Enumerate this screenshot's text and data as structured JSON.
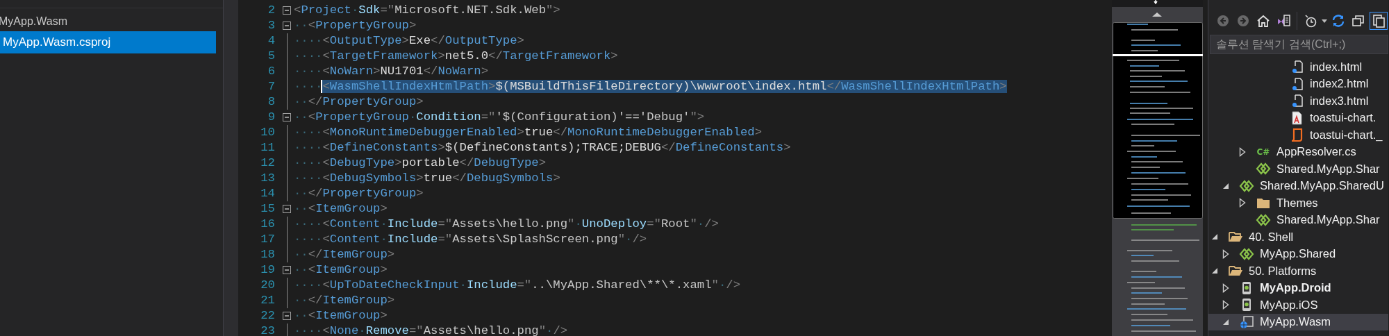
{
  "left_panel": {
    "project": "MyApp.Wasm",
    "files": [
      {
        "label": "MyApp.Wasm.csproj",
        "selected": true
      }
    ]
  },
  "editor": {
    "lines": [
      {
        "number": "2",
        "selected": false,
        "expanded": true,
        "tokens": [
          {
            "kind": "punct",
            "text": "<"
          },
          {
            "kind": "tag",
            "text": "Project"
          },
          {
            "kind": "space",
            "text": "·"
          },
          {
            "kind": "attr",
            "text": "Sdk"
          },
          {
            "kind": "punct",
            "text": "=\""
          },
          {
            "kind": "value",
            "text": "Microsoft.NET.Sdk.Web"
          },
          {
            "kind": "punct",
            "text": "\">"
          }
        ]
      },
      {
        "number": "3",
        "selected": false,
        "expanded": true,
        "indent": "··",
        "tokens": [
          {
            "kind": "punct",
            "text": "<"
          },
          {
            "kind": "tag",
            "text": "PropertyGroup"
          },
          {
            "kind": "punct",
            "text": ">"
          }
        ]
      },
      {
        "number": "4",
        "selected": false,
        "indent": "····",
        "tokens": [
          {
            "kind": "punct",
            "text": "<"
          },
          {
            "kind": "tag",
            "text": "OutputType"
          },
          {
            "kind": "punct",
            "text": ">"
          },
          {
            "kind": "text",
            "text": "Exe"
          },
          {
            "kind": "punct",
            "text": "</"
          },
          {
            "kind": "tag",
            "text": "OutputType"
          },
          {
            "kind": "punct",
            "text": ">"
          }
        ]
      },
      {
        "number": "5",
        "selected": false,
        "indent": "····",
        "tokens": [
          {
            "kind": "punct",
            "text": "<"
          },
          {
            "kind": "tag",
            "text": "TargetFramework"
          },
          {
            "kind": "punct",
            "text": ">"
          },
          {
            "kind": "text",
            "text": "net5.0"
          },
          {
            "kind": "punct",
            "text": "</"
          },
          {
            "kind": "tag",
            "text": "TargetFramework"
          },
          {
            "kind": "punct",
            "text": ">"
          }
        ]
      },
      {
        "number": "6",
        "selected": false,
        "indent": "····",
        "tokens": [
          {
            "kind": "punct",
            "text": "<"
          },
          {
            "kind": "tag",
            "text": "NoWarn"
          },
          {
            "kind": "punct",
            "text": ">"
          },
          {
            "kind": "text",
            "text": "NU1701"
          },
          {
            "kind": "punct",
            "text": "</"
          },
          {
            "kind": "tag",
            "text": "NoWarn"
          },
          {
            "kind": "punct",
            "text": ">"
          }
        ]
      },
      {
        "number": "7",
        "selected": true,
        "indent": "····",
        "tokens": [
          {
            "kind": "punct",
            "text": "<"
          },
          {
            "kind": "tag",
            "text": "WasmShellIndexHtmlPath"
          },
          {
            "kind": "punct",
            "text": ">"
          },
          {
            "kind": "text",
            "text": "$(MSBuildThisFileDirectory)\\wwwroot\\index.html"
          },
          {
            "kind": "punct",
            "text": "</"
          },
          {
            "kind": "tag",
            "text": "WasmShellIndexHtmlPath"
          },
          {
            "kind": "punct",
            "text": ">"
          }
        ]
      },
      {
        "number": "8",
        "selected": false,
        "indent": "··",
        "tokens": [
          {
            "kind": "punct",
            "text": "</"
          },
          {
            "kind": "tag",
            "text": "PropertyGroup"
          },
          {
            "kind": "punct",
            "text": ">"
          }
        ]
      },
      {
        "number": "9",
        "selected": false,
        "expanded": true,
        "indent": "··",
        "tokens": [
          {
            "kind": "punct",
            "text": "<"
          },
          {
            "kind": "tag",
            "text": "PropertyGroup"
          },
          {
            "kind": "space",
            "text": "·"
          },
          {
            "kind": "attr",
            "text": "Condition"
          },
          {
            "kind": "punct",
            "text": "=\""
          },
          {
            "kind": "value",
            "text": "'$(Configuration)'=='Debug'"
          },
          {
            "kind": "punct",
            "text": "\">"
          }
        ]
      },
      {
        "number": "10",
        "selected": false,
        "indent": "····",
        "tokens": [
          {
            "kind": "punct",
            "text": "<"
          },
          {
            "kind": "tag",
            "text": "MonoRuntimeDebuggerEnabled"
          },
          {
            "kind": "punct",
            "text": ">"
          },
          {
            "kind": "text",
            "text": "true"
          },
          {
            "kind": "punct",
            "text": "</"
          },
          {
            "kind": "tag",
            "text": "MonoRuntimeDebuggerEnabled"
          },
          {
            "kind": "punct",
            "text": ">"
          }
        ]
      },
      {
        "number": "11",
        "selected": false,
        "indent": "····",
        "tokens": [
          {
            "kind": "punct",
            "text": "<"
          },
          {
            "kind": "tag",
            "text": "DefineConstants"
          },
          {
            "kind": "punct",
            "text": ">"
          },
          {
            "kind": "text",
            "text": "$(DefineConstants);TRACE;DEBUG"
          },
          {
            "kind": "punct",
            "text": "</"
          },
          {
            "kind": "tag",
            "text": "DefineConstants"
          },
          {
            "kind": "punct",
            "text": ">"
          }
        ]
      },
      {
        "number": "12",
        "selected": false,
        "indent": "····",
        "tokens": [
          {
            "kind": "punct",
            "text": "<"
          },
          {
            "kind": "tag",
            "text": "DebugType"
          },
          {
            "kind": "punct",
            "text": ">"
          },
          {
            "kind": "text",
            "text": "portable"
          },
          {
            "kind": "punct",
            "text": "</"
          },
          {
            "kind": "tag",
            "text": "DebugType"
          },
          {
            "kind": "punct",
            "text": ">"
          }
        ]
      },
      {
        "number": "13",
        "selected": false,
        "indent": "····",
        "tokens": [
          {
            "kind": "punct",
            "text": "<"
          },
          {
            "kind": "tag",
            "text": "DebugSymbols"
          },
          {
            "kind": "punct",
            "text": ">"
          },
          {
            "kind": "text",
            "text": "true"
          },
          {
            "kind": "punct",
            "text": "</"
          },
          {
            "kind": "tag",
            "text": "DebugSymbols"
          },
          {
            "kind": "punct",
            "text": ">"
          }
        ]
      },
      {
        "number": "14",
        "selected": false,
        "indent": "··",
        "tokens": [
          {
            "kind": "punct",
            "text": "</"
          },
          {
            "kind": "tag",
            "text": "PropertyGroup"
          },
          {
            "kind": "punct",
            "text": ">"
          }
        ]
      },
      {
        "number": "15",
        "selected": false,
        "expanded": true,
        "indent": "··",
        "tokens": [
          {
            "kind": "punct",
            "text": "<"
          },
          {
            "kind": "tag",
            "text": "ItemGroup"
          },
          {
            "kind": "punct",
            "text": ">"
          }
        ]
      },
      {
        "number": "16",
        "selected": false,
        "indent": "····",
        "tokens": [
          {
            "kind": "punct",
            "text": "<"
          },
          {
            "kind": "tag",
            "text": "Content"
          },
          {
            "kind": "space",
            "text": "·"
          },
          {
            "kind": "attr",
            "text": "Include"
          },
          {
            "kind": "punct",
            "text": "=\""
          },
          {
            "kind": "value",
            "text": "Assets\\hello.png"
          },
          {
            "kind": "punct",
            "text": "\""
          },
          {
            "kind": "space",
            "text": "·"
          },
          {
            "kind": "attr",
            "text": "UnoDeploy"
          },
          {
            "kind": "punct",
            "text": "=\""
          },
          {
            "kind": "value",
            "text": "Root"
          },
          {
            "kind": "punct",
            "text": "\""
          },
          {
            "kind": "space",
            "text": "·"
          },
          {
            "kind": "punct",
            "text": "/>"
          }
        ]
      },
      {
        "number": "17",
        "selected": false,
        "indent": "····",
        "tokens": [
          {
            "kind": "punct",
            "text": "<"
          },
          {
            "kind": "tag",
            "text": "Content"
          },
          {
            "kind": "space",
            "text": "·"
          },
          {
            "kind": "attr",
            "text": "Include"
          },
          {
            "kind": "punct",
            "text": "=\""
          },
          {
            "kind": "value",
            "text": "Assets\\SplashScreen.png"
          },
          {
            "kind": "punct",
            "text": "\""
          },
          {
            "kind": "space",
            "text": "·"
          },
          {
            "kind": "punct",
            "text": "/>"
          }
        ]
      },
      {
        "number": "18",
        "selected": false,
        "indent": "··",
        "tokens": [
          {
            "kind": "punct",
            "text": "</"
          },
          {
            "kind": "tag",
            "text": "ItemGroup"
          },
          {
            "kind": "punct",
            "text": ">"
          }
        ]
      },
      {
        "number": "19",
        "selected": false,
        "expanded": true,
        "indent": "··",
        "tokens": [
          {
            "kind": "punct",
            "text": "<"
          },
          {
            "kind": "tag",
            "text": "ItemGroup"
          },
          {
            "kind": "punct",
            "text": ">"
          }
        ]
      },
      {
        "number": "20",
        "selected": false,
        "indent": "····",
        "tokens": [
          {
            "kind": "punct",
            "text": "<"
          },
          {
            "kind": "tag",
            "text": "UpToDateCheckInput"
          },
          {
            "kind": "space",
            "text": "·"
          },
          {
            "kind": "attr",
            "text": "Include"
          },
          {
            "kind": "punct",
            "text": "=\""
          },
          {
            "kind": "value",
            "text": "..\\MyApp.Shared\\**\\*.xaml"
          },
          {
            "kind": "punct",
            "text": "\""
          },
          {
            "kind": "space",
            "text": "·"
          },
          {
            "kind": "punct",
            "text": "/>"
          }
        ]
      },
      {
        "number": "21",
        "selected": false,
        "indent": "··",
        "tokens": [
          {
            "kind": "punct",
            "text": "</"
          },
          {
            "kind": "tag",
            "text": "ItemGroup"
          },
          {
            "kind": "punct",
            "text": ">"
          }
        ]
      },
      {
        "number": "22",
        "selected": false,
        "expanded": true,
        "indent": "··",
        "tokens": [
          {
            "kind": "punct",
            "text": "<"
          },
          {
            "kind": "tag",
            "text": "ItemGroup"
          },
          {
            "kind": "punct",
            "text": ">"
          }
        ]
      },
      {
        "number": "23",
        "selected": false,
        "indent": "····",
        "tokens": [
          {
            "kind": "punct",
            "text": "<"
          },
          {
            "kind": "tag",
            "text": "None"
          },
          {
            "kind": "space",
            "text": "·"
          },
          {
            "kind": "attr",
            "text": "Remove"
          },
          {
            "kind": "punct",
            "text": "=\""
          },
          {
            "kind": "value",
            "text": "Assets\\hello.png"
          },
          {
            "kind": "punct",
            "text": "\""
          },
          {
            "kind": "space",
            "text": "·"
          },
          {
            "kind": "punct",
            "text": "/>"
          }
        ]
      }
    ]
  },
  "solution_explorer": {
    "toolbar": [
      {
        "kind": "back",
        "disabled": true,
        "pressed": false
      },
      {
        "kind": "forward",
        "disabled": true,
        "pressed": false
      },
      {
        "kind": "home",
        "disabled": false,
        "pressed": false
      },
      {
        "kind": "switch_views",
        "disabled": false,
        "pressed": false
      },
      {
        "kind": "separator"
      },
      {
        "kind": "history",
        "disabled": false,
        "pressed": false
      },
      {
        "kind": "sync",
        "disabled": false,
        "pressed": false
      },
      {
        "kind": "collapse_all",
        "disabled": false,
        "pressed": false
      },
      {
        "kind": "show_all",
        "disabled": false,
        "pressed": true
      }
    ],
    "search": {
      "placeholder": "솔루션 탐색기 검색(Ctrl+;)"
    },
    "tree": [
      {
        "children": [
          {
            "children": [
              {
                "children": [
                  {
                    "children": [
                      {
                        "label": "index.html",
                        "kind": "html",
                        "selected": false
                      },
                      {
                        "label": "index2.html",
                        "kind": "html",
                        "selected": false
                      },
                      {
                        "label": "index3.html",
                        "kind": "html",
                        "selected": false
                      },
                      {
                        "label": "toastui-chart.",
                        "kind": "pdf",
                        "selected": false
                      },
                      {
                        "label": "toastui-chart._",
                        "kind": "script",
                        "selected": false
                      }
                    ]
                  }
                ]
              },
              {
                "label": "AppResolver.cs",
                "kind": "csharp",
                "icon_text": "C#",
                "expanded": false,
                "selected": false
              },
              {
                "label": "Shared.MyApp.Shar",
                "kind": "shared",
                "selected": false
              }
            ]
          },
          {
            "label": "Shared.MyApp.SharedU",
            "kind": "shared",
            "expanded": true,
            "selected": false,
            "children": [
              {
                "label": "Themes",
                "kind": "folder",
                "expanded": false,
                "selected": false
              },
              {
                "label": "Shared.MyApp.Shar",
                "kind": "shared",
                "selected": false
              }
            ]
          }
        ]
      },
      {
        "label": "40. Shell",
        "kind": "folder",
        "expanded": true,
        "selected": false,
        "children": [
          {
            "label": "MyApp.Shared",
            "kind": "shared",
            "expanded": false,
            "selected": false
          }
        ]
      },
      {
        "label": "50. Platforms",
        "kind": "folder",
        "expanded": true,
        "selected": false,
        "children": [
          {
            "label": "MyApp.Droid",
            "kind": "android",
            "expanded": false,
            "bold": true,
            "selected": false
          },
          {
            "label": "MyApp.iOS",
            "kind": "ios",
            "expanded": false,
            "bold": false,
            "selected": false
          },
          {
            "label": "MyApp.Wasm",
            "kind": "web",
            "expanded": true,
            "bold": false,
            "selected": true
          }
        ]
      }
    ]
  }
}
